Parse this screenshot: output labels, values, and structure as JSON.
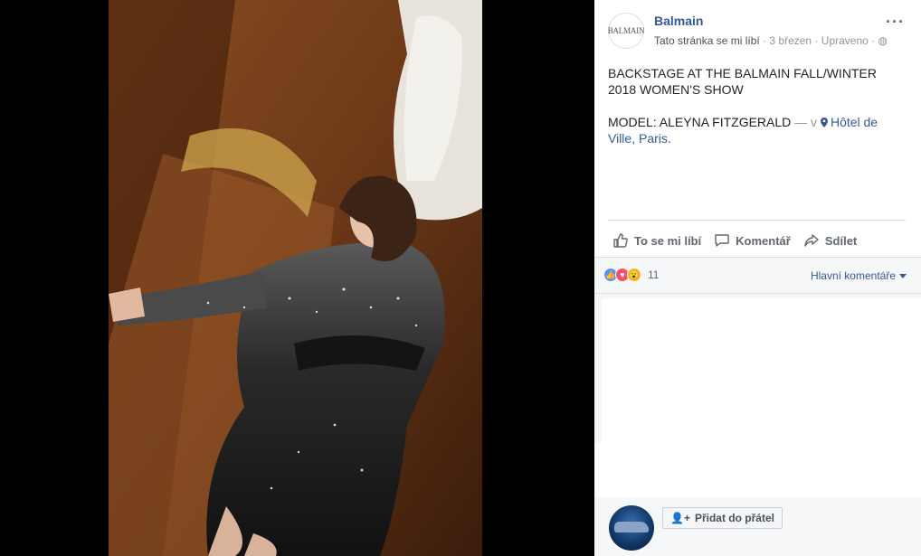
{
  "post": {
    "page_name": "Balmain",
    "avatar_text": "BALMAIN",
    "liked_label": "Tato stránka se mi líbí",
    "date": "3 březen",
    "edited": "Upraveno",
    "text_line1": "BACKSTAGE AT THE BALMAIN FALL/WINTER 2018 WOMEN'S SHOW",
    "model_text": "MODEL: ALEYNA FITZGERALD",
    "location_prefix": "— v",
    "location": "Hôtel de Ville, Paris."
  },
  "actions": {
    "like": "To se mi líbí",
    "comment": "Komentář",
    "share": "Sdílet"
  },
  "reactions": {
    "types": [
      "like",
      "love",
      "wow"
    ],
    "count": "11",
    "sort_label": "Hlavní komentáře"
  },
  "suggestion": {
    "add_friend_label": "Přidat do přátel"
  },
  "colors": {
    "link": "#365899",
    "secondary_text": "#90949c",
    "footer_bg": "#f6f7f9"
  }
}
